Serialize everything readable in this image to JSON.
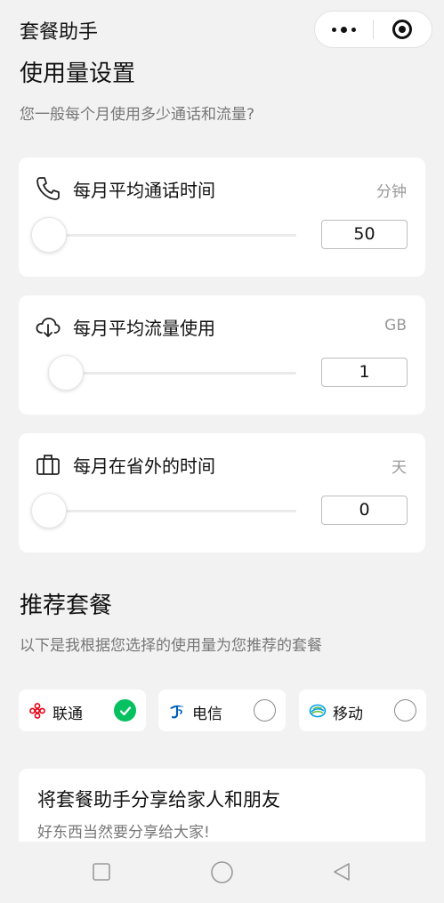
{
  "header": {
    "title": "套餐助手"
  },
  "capsule": {
    "more_icon": "more-dots-icon",
    "close_icon": "target-icon"
  },
  "usage": {
    "title": "使用量设置",
    "subtitle": "您一般每个月使用多少通话和流量?",
    "items": [
      {
        "icon": "phone-icon",
        "label": "每月平均通话时间",
        "unit": "分钟",
        "value": "50"
      },
      {
        "icon": "cloud-download-icon",
        "label": "每月平均流量使用",
        "unit": "GB",
        "value": "1"
      },
      {
        "icon": "briefcase-icon",
        "label": "每月在省外的时间",
        "unit": "天",
        "value": "0"
      }
    ]
  },
  "recommend": {
    "title": "推荐套餐",
    "subtitle": "以下是我根据您选择的使用量为您推荐的套餐",
    "carriers": [
      {
        "name": "联通",
        "logo": "china-unicom-logo",
        "selected": true
      },
      {
        "name": "电信",
        "logo": "china-telecom-logo",
        "selected": false
      },
      {
        "name": "移动",
        "logo": "china-mobile-logo",
        "selected": false
      }
    ]
  },
  "share": {
    "title": "将套餐助手分享给家人和朋友",
    "subtitle": "好东西当然要分享给大家!"
  },
  "colors": {
    "accent": "#07c160",
    "background": "#f2f2f2",
    "card": "#ffffff",
    "unicom_red": "#e60012",
    "telecom_blue": "#0060b6"
  },
  "navbar": {
    "icons": [
      "square-icon",
      "circle-home-icon",
      "triangle-back-icon"
    ]
  }
}
